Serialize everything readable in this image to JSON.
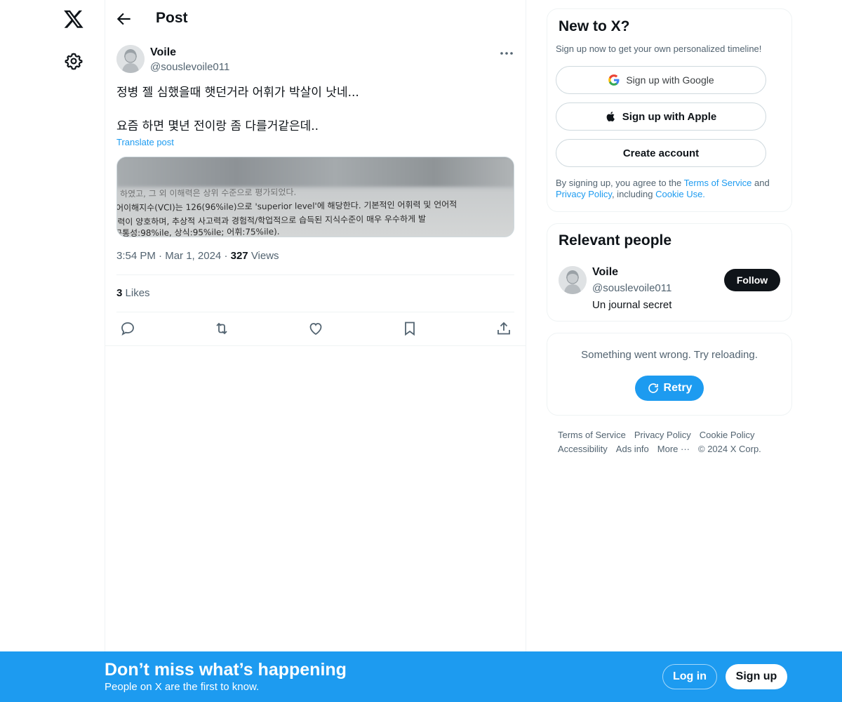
{
  "nav": {
    "logo_icon": "x-logo-icon",
    "settings_icon": "gear-icon"
  },
  "header": {
    "title": "Post",
    "back_icon": "arrow-left-icon"
  },
  "post": {
    "author_name": "Voile",
    "author_handle": "@souslevoile011",
    "text_lines": [
      "정병 젤 심했을때 햇던거라 어휘가 박살이 낫네...",
      "",
      "요즘 하면 몇년 전이랑 좀 다를거같은데.."
    ],
    "translate_label": "Translate post",
    "media_text": [
      "하였고, 그 외 이해력은 상위 수준으로 평가되었다.",
      "어이해지수(VCI)는 126(96%ile)으로 'superior level'에 해당한다. 기본적인 어휘력 및 언어적",
      "-력이 양호하며, 추상적 사고력과 경험적/학업적으로 습득된 지식수준이 매우 우수하게 발",
      "공통성:98%ile, 상식:95%ile; 어휘:75%ile)."
    ],
    "time": "3:54 PM",
    "date": "Mar 1, 2024",
    "views_count": "327",
    "views_label": "Views",
    "likes_count": "3",
    "likes_label": "Likes",
    "actions": [
      "reply-icon",
      "repost-icon",
      "like-icon",
      "bookmark-icon",
      "share-icon"
    ]
  },
  "signup_card": {
    "title": "New to X?",
    "subtitle": "Sign up now to get your own personalized timeline!",
    "google_label": "Sign up with Google",
    "apple_label": "Sign up with Apple",
    "create_label": "Create account",
    "legal_prefix": "By signing up, you agree to the ",
    "terms": "Terms of Service",
    "and": " and",
    "privacy": "Privacy Policy",
    "including": ", including ",
    "cookie": "Cookie Use."
  },
  "relevant": {
    "title": "Relevant people",
    "name": "Voile",
    "handle": "@souslevoile011",
    "bio": "Un journal secret",
    "follow_label": "Follow"
  },
  "error_card": {
    "message": "Something went wrong. Try reloading.",
    "retry_label": "Retry"
  },
  "footer": {
    "links": [
      "Terms of Service",
      "Privacy Policy",
      "Cookie Policy",
      "Accessibility",
      "Ads info",
      "More ···",
      "© 2024 X Corp."
    ]
  },
  "banner": {
    "title": "Don’t miss what’s happening",
    "subtitle": "People on X are the first to know.",
    "login_label": "Log in",
    "signup_label": "Sign up"
  },
  "colors": {
    "accent": "#1d9bf0",
    "text": "#0f1419",
    "muted": "#536471"
  }
}
